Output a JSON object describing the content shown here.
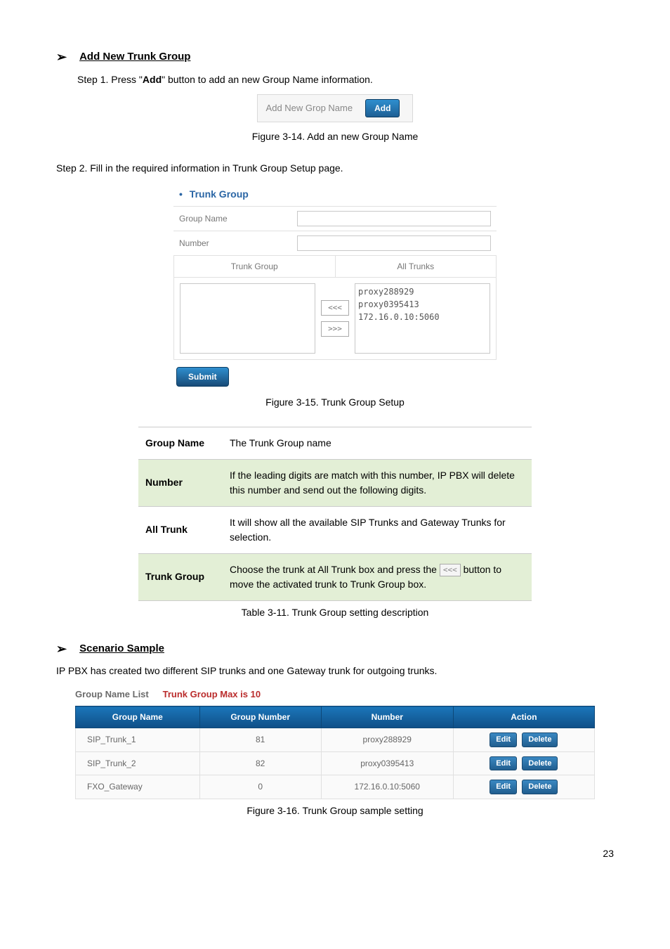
{
  "sections": {
    "add_new_trunk_group": "Add New Trunk Group",
    "scenario_sample": "Scenario Sample"
  },
  "steps": {
    "step1_prefix": "Step 1. Press \"",
    "step1_bold": "Add",
    "step1_suffix": "\" button to add an new Group Name information.",
    "step2": "Step 2. Fill in the required information in Trunk Group Setup page."
  },
  "add_bar": {
    "label": "Add New Grop Name",
    "button": "Add"
  },
  "captions": {
    "fig314": "Figure 3-14. Add an new Group Name",
    "fig315": "Figure 3-15. Trunk Group Setup",
    "tab311": "Table 3-11. Trunk Group setting description",
    "fig316": "Figure 3-16. Trunk Group sample setting"
  },
  "trunk_group_panel": {
    "title": "Trunk Group",
    "group_name_label": "Group Name",
    "number_label": "Number",
    "trunk_group_col": "Trunk Group",
    "all_trunks_col": "All Trunks",
    "left_items": [],
    "right_items": [
      "proxy288929",
      "proxy0395413",
      "172.16.0.10:5060"
    ],
    "btn_left": "<<<",
    "btn_right": ">>>",
    "submit": "Submit"
  },
  "desc_table": [
    {
      "key": "Group Name",
      "value": "The Trunk Group name",
      "shade": false
    },
    {
      "key": "Number",
      "value": "If the leading digits are match with this number, IP PBX will delete this number and send out the following digits.",
      "shade": true
    },
    {
      "key": "All Trunk",
      "value": "It will show all the available SIP Trunks and Gateway Trunks for selection.",
      "shade": false
    },
    {
      "key": "Trunk Group",
      "value_pre": "Choose the trunk at All Trunk box and press the ",
      "btn": "<<<",
      "value_post": " button to move the activated trunk to Trunk Group box.",
      "shade": true
    }
  ],
  "scenario_intro": "IP PBX has created two different SIP trunks and one Gateway trunk for outgoing trunks.",
  "group_name_list": {
    "title1": "Group Name List",
    "title2": "Trunk Group Max is 10",
    "headers": {
      "name": "Group Name",
      "number": "Group Number",
      "num": "Number",
      "action": "Action"
    },
    "rows": [
      {
        "name": "SIP_Trunk_1",
        "group_number": "81",
        "number": "proxy288929"
      },
      {
        "name": "SIP_Trunk_2",
        "group_number": "82",
        "number": "proxy0395413"
      },
      {
        "name": "FXO_Gateway",
        "group_number": "0",
        "number": "172.16.0.10:5060"
      }
    ],
    "edit": "Edit",
    "delete": "Delete"
  },
  "page_number": "23"
}
